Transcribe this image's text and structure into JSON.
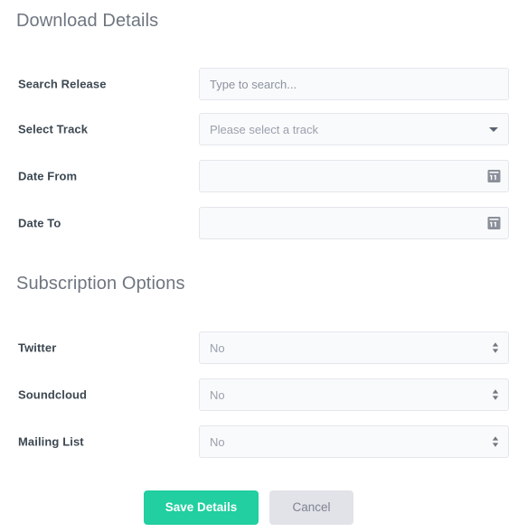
{
  "sections": {
    "download": {
      "heading": "Download Details",
      "fields": [
        {
          "label": "Search Release",
          "type": "text",
          "value": "",
          "placeholder": "Type to search...",
          "name": "search-release"
        },
        {
          "label": "Select Track",
          "type": "select",
          "value": "Please select a track",
          "icon": "chevron-down-icon",
          "name": "select-track"
        },
        {
          "label": "Date From",
          "type": "date",
          "value": "",
          "placeholder": "",
          "icon": "calendar-icon",
          "name": "date-from"
        },
        {
          "label": "Date To",
          "type": "date",
          "value": "",
          "placeholder": "",
          "icon": "calendar-icon",
          "name": "date-to"
        }
      ]
    },
    "subscription": {
      "heading": "Subscription Options",
      "fields": [
        {
          "label": "Twitter",
          "type": "select",
          "value": "No",
          "icon": "spinner-arrows-icon",
          "name": "twitter"
        },
        {
          "label": "Soundcloud",
          "type": "select",
          "value": "No",
          "icon": "spinner-arrows-icon",
          "name": "soundcloud"
        },
        {
          "label": "Mailing List",
          "type": "select",
          "value": "No",
          "icon": "spinner-arrows-icon",
          "name": "mailing-list"
        }
      ]
    }
  },
  "buttons": {
    "save_label": "Save Details",
    "cancel_label": "Cancel"
  },
  "colors": {
    "accent_green": "#21cfa0",
    "cancel_grey": "#e2e3e9",
    "field_bg": "#f9fafb",
    "field_border": "#e5e6ec",
    "label_text": "#3d4852",
    "heading_text": "#6f7680",
    "placeholder_text": "#8c93a0"
  }
}
